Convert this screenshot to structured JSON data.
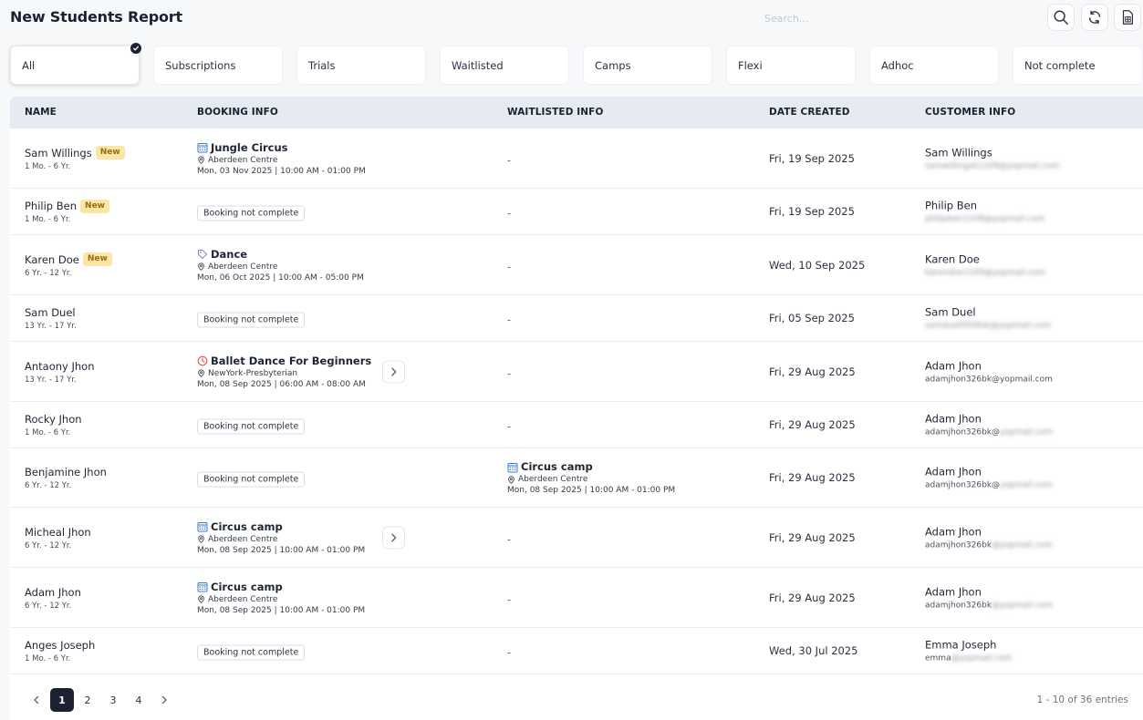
{
  "header": {
    "title": "New Students Report",
    "search_placeholder": "Search..."
  },
  "tabs": [
    {
      "label": "All",
      "active": true
    },
    {
      "label": "Subscriptions"
    },
    {
      "label": "Trials"
    },
    {
      "label": "Waitlisted"
    },
    {
      "label": "Camps"
    },
    {
      "label": "Flexi"
    },
    {
      "label": "Adhoc"
    },
    {
      "label": "Not complete"
    }
  ],
  "columns": {
    "name": "NAME",
    "booking": "BOOKING INFO",
    "waitlisted": "WAITLISTED INFO",
    "date": "DATE CREATED",
    "customer": "CUSTOMER INFO"
  },
  "new_badge": "New",
  "booking_not_complete": "Booking not complete",
  "dash": "-",
  "rows": [
    {
      "name": "Sam Willings",
      "age": "1 Mo. - 6 Yr.",
      "booking": {
        "icon": "calendar-icon",
        "title": "Jungle Circus",
        "location": "Aberdeen Centre",
        "time": "Mon, 03 Nov 2025 | 10:00 AM - 01:00 PM"
      },
      "date": "Fri, 19 Sep 2025",
      "customer": "Sam Willings",
      "email_visible": "",
      "email_hidden": "samwillingsk1109@yopmail.com"
    },
    {
      "name": "Philip Ben",
      "age": "1 Mo. - 6 Yr.",
      "date": "Fri, 19 Sep 2025",
      "customer": "Philip Ben",
      "email_visible": "",
      "email_hidden": "philipben1109@yopmail.com"
    },
    {
      "name": "Karen Doe",
      "age": "6 Yr. - 12 Yr.",
      "booking": {
        "icon": "tag-icon",
        "title": "Dance",
        "location": "Aberdeen Centre",
        "time": "Mon, 06 Oct 2025 | 10:00 AM - 05:00 PM"
      },
      "date": "Wed, 10 Sep 2025",
      "customer": "Karen Doe",
      "email_visible": "",
      "email_hidden": "karendoe1109@yopmail.com"
    },
    {
      "name": "Sam Duel",
      "age": "13 Yr. - 17 Yr.",
      "date": "Fri, 05 Sep 2025",
      "customer": "Sam Duel",
      "email_visible": "",
      "email_hidden": "samduel0509sk@yopmail.com"
    },
    {
      "name": "Antaony Jhon",
      "age": "13 Yr. - 17 Yr.",
      "booking": {
        "icon": "clock-icon",
        "title": "Ballet Dance For Beginners",
        "location": "NewYork-Presbyterian",
        "time": "Mon, 08 Sep 2025 | 06:00 AM - 08:00 AM"
      },
      "date": "Fri, 29 Aug 2025",
      "customer": "Adam Jhon",
      "email_visible": "adamjhon326bk@yopmail.com",
      "email_hidden": ""
    },
    {
      "name": "Rocky Jhon",
      "age": "1 Mo. - 6 Yr.",
      "date": "Fri, 29 Aug 2025",
      "customer": "Adam Jhon",
      "email_visible": "adamjhon326bk@",
      "email_hidden": "yopmail.com"
    },
    {
      "name": "Benjamine Jhon",
      "age": "6 Yr. - 12 Yr.",
      "waitlisted": {
        "icon": "calendar-icon",
        "title": "Circus camp",
        "location": "Aberdeen Centre",
        "time": "Mon, 08 Sep 2025 | 10:00 AM - 01:00 PM"
      },
      "date": "Fri, 29 Aug 2025",
      "customer": "Adam Jhon",
      "email_visible": "adamjhon326bk@",
      "email_hidden": "yopmail.com"
    },
    {
      "name": "Micheal Jhon",
      "age": "6 Yr. - 12 Yr.",
      "booking": {
        "icon": "calendar-icon",
        "title": "Circus camp",
        "location": "Aberdeen Centre",
        "time": "Mon, 08 Sep 2025 | 10:00 AM - 01:00 PM"
      },
      "date": "Fri, 29 Aug 2025",
      "customer": "Adam Jhon",
      "email_visible": "adamjhon326bk",
      "email_hidden": "@yopmail.com"
    },
    {
      "name": "Adam Jhon",
      "age": "6 Yr. - 12 Yr.",
      "booking": {
        "icon": "calendar-icon",
        "title": "Circus camp",
        "location": "Aberdeen Centre",
        "time": "Mon, 08 Sep 2025 | 10:00 AM - 01:00 PM"
      },
      "date": "Fri, 29 Aug 2025",
      "customer": "Adam Jhon",
      "email_visible": "adamjhon326bk",
      "email_hidden": "@yopmail.com"
    },
    {
      "name": "Anges Joseph",
      "age": "1 Mo. - 6 Yr.",
      "date": "Wed, 30 Jul 2025",
      "customer": "Emma Joseph",
      "email_visible": "emma",
      "email_hidden": "@yopmail.com"
    }
  ],
  "pagination": {
    "pages": [
      "1",
      "2",
      "3",
      "4"
    ],
    "current": "1",
    "entries_label": "1 - 10 of 36 entries"
  },
  "colors": {
    "accent_dark": "#1d2230",
    "header_bg": "#e6ebf2",
    "new_badge_bg": "#fbe6a6",
    "calendar_icon": "#3a7bd5",
    "tag_icon": "#9b7fd4",
    "clock_icon": "#e8553e"
  }
}
